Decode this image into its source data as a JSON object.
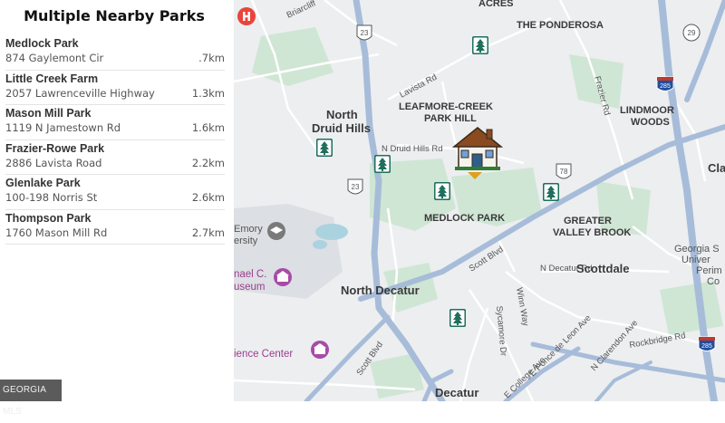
{
  "panel": {
    "title": "Multiple Nearby Parks",
    "parks": [
      {
        "name": "Medlock Park",
        "address": "874 Gaylemont Cir",
        "distance": ".7km"
      },
      {
        "name": "Little Creek Farm",
        "address": "2057 Lawrenceville Highway",
        "distance": "1.3km"
      },
      {
        "name": "Mason Mill Park",
        "address": "1119 N Jamestown Rd",
        "distance": "1.6km"
      },
      {
        "name": "Frazier-Rowe Park",
        "address": "2886 Lavista Road",
        "distance": "2.2km"
      },
      {
        "name": "Glenlake Park",
        "address": "100-198 Norris St",
        "distance": "2.6km"
      },
      {
        "name": "Thompson Park",
        "address": "1760 Mason Mill Rd",
        "distance": "2.7km"
      }
    ]
  },
  "map": {
    "areas": {
      "acres": "ACRES",
      "ponderosa": "THE PONDEROSA",
      "north_druid_1": "North",
      "north_druid_2": "Druid Hills",
      "leafmore_1": "LEAFMORE-CREEK",
      "leafmore_2": "PARK HILL",
      "lindmoor_1": "LINDMOOR",
      "lindmoor_2": "WOODS",
      "medlock_park": "MEDLOCK PARK",
      "greater_valley_1": "GREATER",
      "greater_valley_2": "VALLEY BROOK",
      "north_decatur": "North Decatur",
      "scottdale": "Scottdale",
      "decatur": "Decatur",
      "georgia_1": "Georgia S",
      "georgia_2": "Univer",
      "georgia_3": "Perim",
      "georgia_4": "Co",
      "cla": "Cla",
      "emory_1": "Emory",
      "emory_2": "ersity",
      "michael_1": "nael C.",
      "michael_2": "useum",
      "science": "ience Center"
    },
    "roads": {
      "briarcliff": "Briarcliff",
      "lavista": "Lavista Rd",
      "n_druid_hills": "N Druid Hills Rd",
      "frazier": "Frazier Rd",
      "scott_blvd_1": "Scott Blvd",
      "scott_blvd_2": "Scott Blvd",
      "n_decatur": "N Decatur Rd",
      "winn_way": "Winn Way",
      "sycamore": "Sycamore Dr",
      "e_ponce": "E Ponce de Leon Ave",
      "n_clarendon": "N Clarendon Ave",
      "rockbridge": "Rockbridge Rd",
      "e_college": "E College Ave"
    },
    "shields": {
      "us23_top": "23",
      "us23_mid": "23",
      "us78": "78",
      "i285_top": "285",
      "i285_bottom": "285",
      "sr29": "29"
    },
    "icons": {
      "hospital": "hospital-icon",
      "park": "park-tree-icon",
      "home": "home-marker-icon"
    },
    "colors": {
      "park_green": "#1f6f5c",
      "highway_blue": "#a7bcd9",
      "home_brown": "#8a4b20"
    }
  },
  "logo": {
    "text": "GEORGIA MLS"
  }
}
